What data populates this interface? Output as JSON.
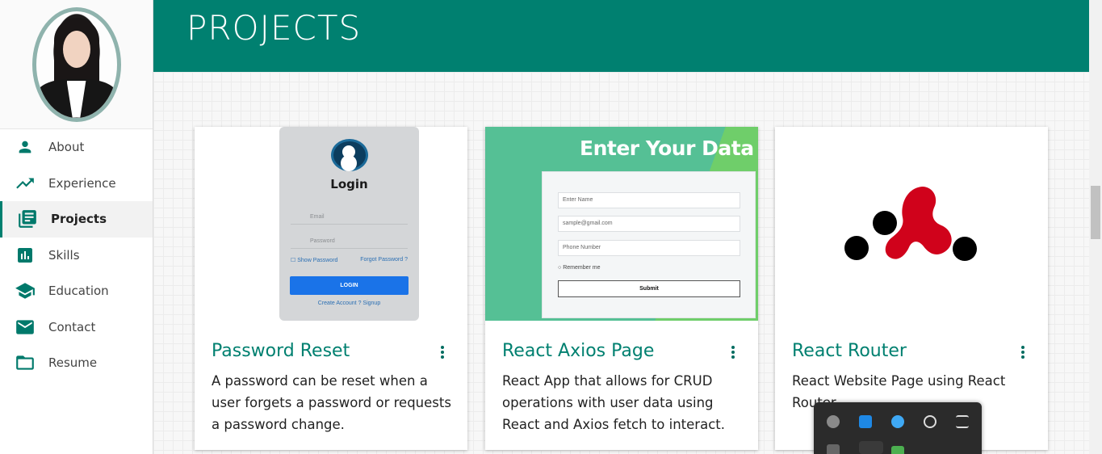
{
  "header": {
    "title": "PROJECTS"
  },
  "sidebar": {
    "items": [
      {
        "label": "About",
        "icon": "person-icon",
        "active": false
      },
      {
        "label": "Experience",
        "icon": "trending-up-icon",
        "active": false
      },
      {
        "label": "Projects",
        "icon": "library-books-icon",
        "active": true
      },
      {
        "label": "Skills",
        "icon": "bar-chart-icon",
        "active": false
      },
      {
        "label": "Education",
        "icon": "school-icon",
        "active": false
      },
      {
        "label": "Contact",
        "icon": "email-icon",
        "active": false
      },
      {
        "label": "Resume",
        "icon": "folder-icon",
        "active": false
      }
    ]
  },
  "projects": [
    {
      "title": "Password Reset",
      "description": "A password can be reset when a user forgets a password or requests a password change.",
      "mock": {
        "heading": "Login",
        "email_placeholder": "Email",
        "password_placeholder": "Password",
        "show_password": "Show Password",
        "forgot_password": "Forgot Password ?",
        "button": "LOGIN",
        "links": "Create Account ?   Signup"
      }
    },
    {
      "title": "React Axios Page",
      "description": "React App that allows for CRUD operations with user data using React and Axios fetch to interact.",
      "mock": {
        "heading": "Enter Your Data",
        "name_placeholder": "Enter Name",
        "email_value": "sample@gmail.com",
        "phone_placeholder": "Phone Number",
        "remember": "Remember me",
        "submit": "Submit"
      }
    },
    {
      "title": "React Router",
      "description": "React Website Page using React Router",
      "mock": {}
    }
  ],
  "colors": {
    "accent": "#008070",
    "router_red": "#d0021b"
  }
}
